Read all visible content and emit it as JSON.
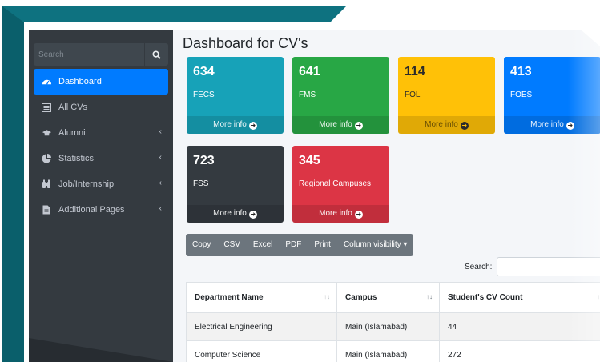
{
  "sidebar": {
    "search_placeholder": "Search",
    "items": [
      {
        "label": "Dashboard",
        "icon": "dashboard-icon",
        "active": true
      },
      {
        "label": "All CVs",
        "icon": "list-icon"
      },
      {
        "label": "Alumni",
        "icon": "graduation-cap-icon",
        "has_submenu": true
      },
      {
        "label": "Statistics",
        "icon": "pie-chart-icon",
        "has_submenu": true
      },
      {
        "label": "Job/Internship",
        "icon": "binoculars-icon",
        "has_submenu": true
      },
      {
        "label": "Additional Pages",
        "icon": "file-icon",
        "has_submenu": true
      }
    ]
  },
  "page": {
    "title": "Dashboard for CV's"
  },
  "boxes": [
    {
      "count": "634",
      "label": "FECS",
      "footer": "More info",
      "color": "#17a2b8"
    },
    {
      "count": "641",
      "label": "FMS",
      "footer": "More info",
      "color": "#28a745"
    },
    {
      "count": "114",
      "label": "FOL",
      "footer": "More info",
      "color": "#ffc107"
    },
    {
      "count": "413",
      "label": "FOES",
      "footer": "More info",
      "color": "#007bff"
    },
    {
      "count": "723",
      "label": "FSS",
      "footer": "More info",
      "color": "#343a40"
    },
    {
      "count": "345",
      "label": "Regional Campuses",
      "footer": "More info",
      "color": "#dc3545"
    }
  ],
  "toolbar": {
    "buttons": [
      "Copy",
      "CSV",
      "Excel",
      "PDF",
      "Print",
      "Column visibility"
    ]
  },
  "search": {
    "label": "Search:"
  },
  "table": {
    "headers": [
      "Department Name",
      "Campus",
      "Student's CV Count"
    ],
    "rows": [
      [
        "Electrical Engineering",
        "Main (Islamabad)",
        "44"
      ],
      [
        "Computer Science",
        "Main (Islamabad)",
        "272"
      ]
    ]
  }
}
